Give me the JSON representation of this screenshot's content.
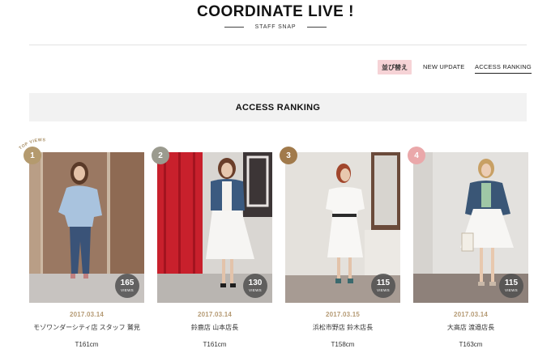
{
  "header": {
    "title": "COORDINATE LIVE !",
    "subtitle": "STAFF SNAP"
  },
  "sort": {
    "badge": "並び替え",
    "new_update": "NEW UPDATE",
    "access_ranking": "ACCESS RANKING"
  },
  "banner": {
    "title": "ACCESS RANKING",
    "top_views": "TOP VIEWS"
  },
  "cards": [
    {
      "rank": "1",
      "views": "165",
      "views_label": "VIEWS",
      "date": "2017.03.14",
      "staff": "モゾワンダーシティ店 スタッフ 鷲見",
      "height": "T161cm",
      "rank_color": "#b49a6e"
    },
    {
      "rank": "2",
      "views": "130",
      "views_label": "VIEWS",
      "date": "2017.03.14",
      "staff": "鈴鹿店 山本店長",
      "height": "T161cm",
      "rank_color": "#9b9b8f"
    },
    {
      "rank": "3",
      "views": "115",
      "views_label": "VIEWS",
      "date": "2017.03.15",
      "staff": "浜松市野店 鈴木店長",
      "height": "T158cm",
      "rank_color": "#a17a4b"
    },
    {
      "rank": "4",
      "views": "115",
      "views_label": "VIEWS",
      "date": "2017.03.14",
      "staff": "大高店 渡邉店長",
      "height": "T163cm",
      "rank_color": "#eaa8aa"
    }
  ]
}
